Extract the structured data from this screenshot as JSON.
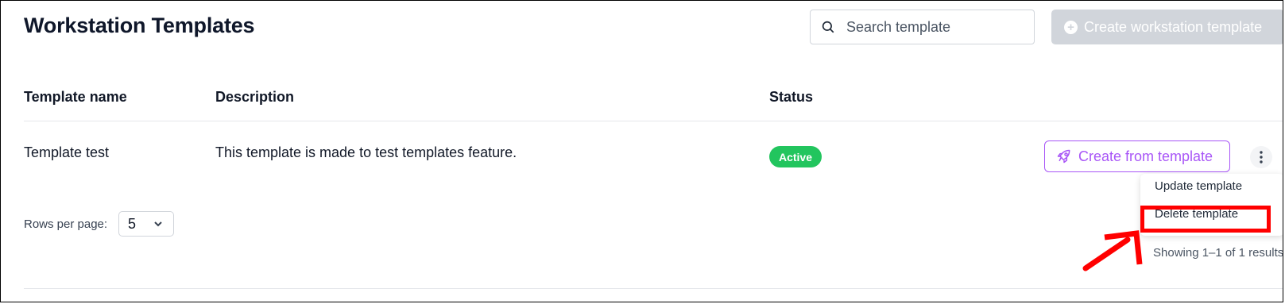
{
  "page_title": "Workstation Templates",
  "search": {
    "placeholder": "Search template",
    "value": ""
  },
  "create_button_label": "Create workstation template",
  "table": {
    "columns": [
      "Template name",
      "Description",
      "Status"
    ],
    "rows": [
      {
        "name": "Template test",
        "description": "This template is made to test templates feature.",
        "status": "Active",
        "action_label": "Create from template"
      }
    ]
  },
  "row_menu": {
    "items": [
      "Update template",
      "Delete template"
    ]
  },
  "pagination": {
    "rows_per_page_label": "Rows per page:",
    "rows_per_page_value": "5",
    "showing_text": "Showing 1–1 of 1 results"
  },
  "colors": {
    "status_active": "#22c55e",
    "accent": "#a855f7",
    "annotation": "#ff0000",
    "button_disabled": "#d1d5db"
  },
  "icons": [
    "search-icon",
    "plus-circle-icon",
    "rocket-icon",
    "kebab-menu-icon",
    "chevron-down-icon"
  ]
}
